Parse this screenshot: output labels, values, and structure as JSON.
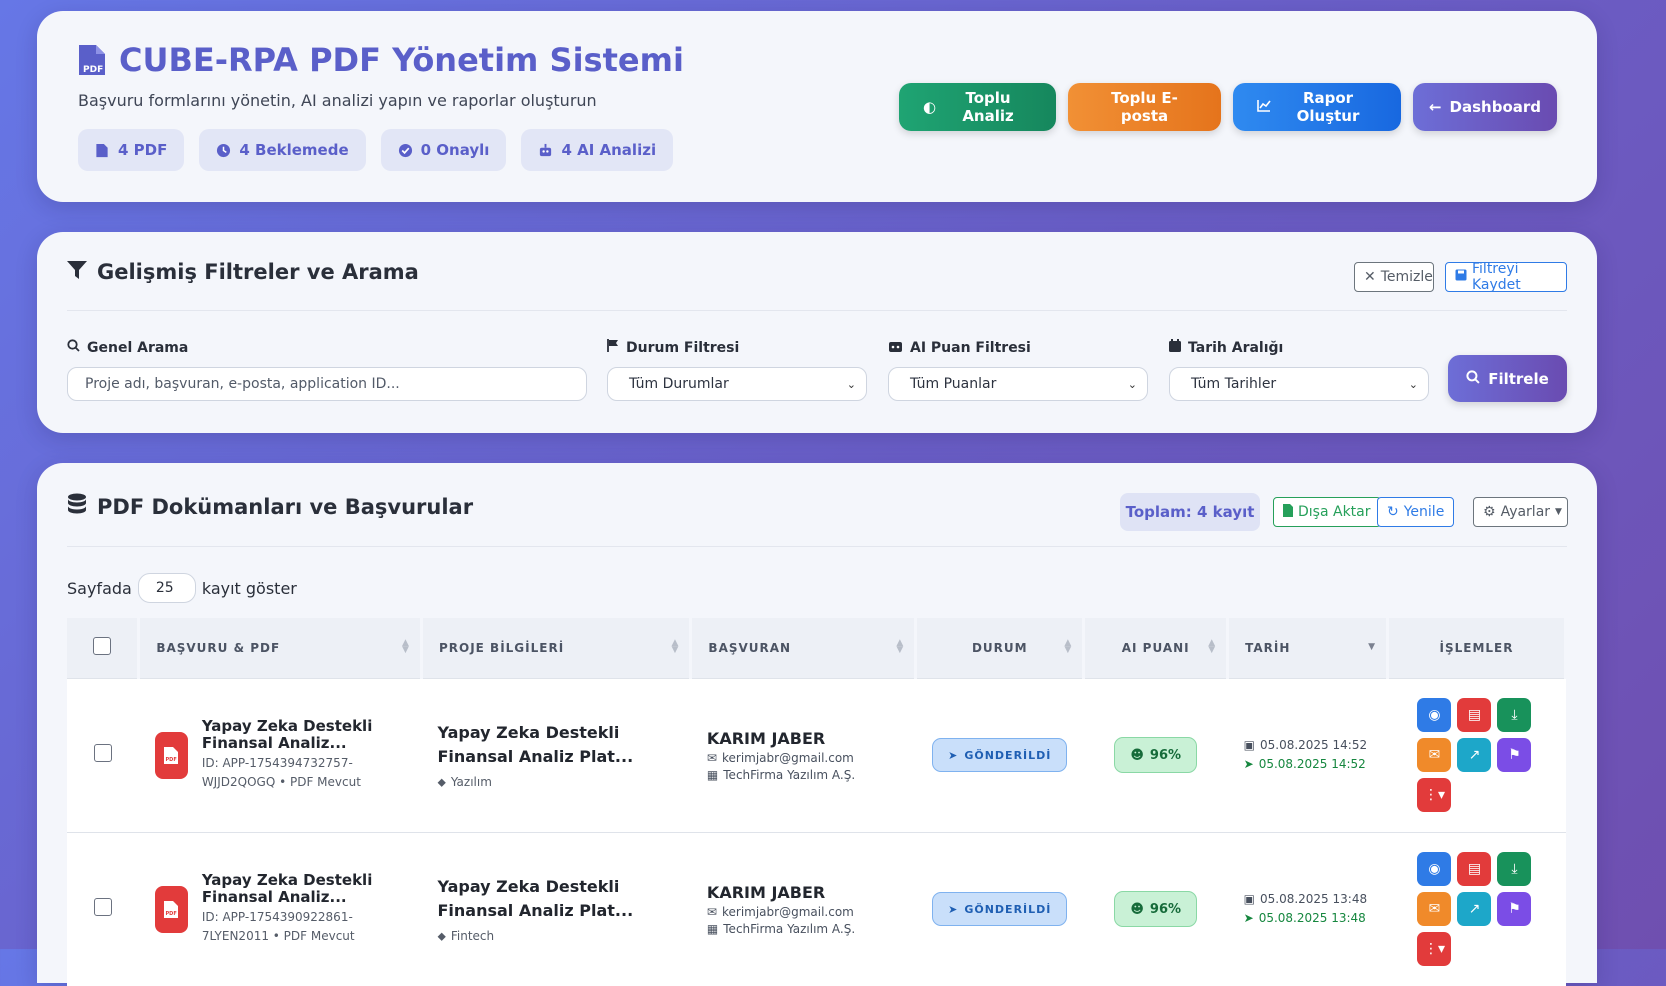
{
  "header": {
    "title": "CUBE-RPA PDF Yönetim Sistemi",
    "subtitle": "Başvuru formlarını yönetin, AI analizi yapın ve raporlar oluşturun",
    "stats": [
      {
        "icon": "file-pdf-icon",
        "label": "4 PDF"
      },
      {
        "icon": "clock-icon",
        "label": "4 Beklemede"
      },
      {
        "icon": "check-circle-icon",
        "label": "0 Onaylı"
      },
      {
        "icon": "robot-icon",
        "label": "4 AI Analizi"
      }
    ],
    "actions": {
      "bulk_analysis": "Toplu Analiz",
      "bulk_email": "Toplu E-posta",
      "create_report": "Rapor Oluştur",
      "dashboard": "Dashboard"
    }
  },
  "filters": {
    "title": "Gelişmiş Filtreler ve Arama",
    "clear_label": "Temizle",
    "save_label": "Filtreyi Kaydet",
    "search_label": "Genel Arama",
    "search_placeholder": "Proje adı, başvuran, e-posta, application ID...",
    "status_label": "Durum Filtresi",
    "status_value": "Tüm Durumlar",
    "ai_label": "AI Puan Filtresi",
    "ai_value": "Tüm Puanlar",
    "date_label": "Tarih Aralığı",
    "date_value": "Tüm Tarihler",
    "filter_button": "Filtrele"
  },
  "docs": {
    "title": "PDF Dokümanları ve Başvurular",
    "total": "Toplam: 4 kayıt",
    "export_label": "Dışa Aktar",
    "refresh_label": "Yenile",
    "settings_label": "Ayarlar",
    "per_page_prefix": "Sayfada",
    "per_page_value": "25",
    "per_page_suffix": "kayıt göster",
    "columns": [
      "BAŞVURU & PDF",
      "PROJE BİLGİLERİ",
      "BAŞVURAN",
      "DURUM",
      "AI PUANI",
      "TARİH",
      "İŞLEMLER"
    ],
    "rows": [
      {
        "app_name": "Yapay Zeka Destekli Finansal Analiz...",
        "app_id_line1": "ID: APP-1754394732757-",
        "app_id_line2": "WJJD2QOGQ • PDF Mevcut",
        "project_name": "Yapay Zeka Destekli Finansal Analiz Plat...",
        "project_tag": "Yazılım",
        "applicant": "KARIM JABER",
        "email": "kerimjabr@gmail.com",
        "company": "TechFirma Yazılım A.Ş.",
        "status": "GÖNDERİLDİ",
        "score": "96%",
        "date_created": "05.08.2025 14:52",
        "date_sent": "05.08.2025 14:52"
      },
      {
        "app_name": "Yapay Zeka Destekli Finansal Analiz...",
        "app_id_line1": "ID: APP-1754390922861-",
        "app_id_line2": "7LYEN2011 • PDF Mevcut",
        "project_name": "Yapay Zeka Destekli Finansal Analiz Plat...",
        "project_tag": "Fintech",
        "applicant": "KARIM JABER",
        "email": "kerimjabr@gmail.com",
        "company": "TechFirma Yazılım A.Ş.",
        "status": "GÖNDERİLDİ",
        "score": "96%",
        "date_created": "05.08.2025 13:48",
        "date_sent": "05.08.2025 13:48"
      }
    ]
  }
}
